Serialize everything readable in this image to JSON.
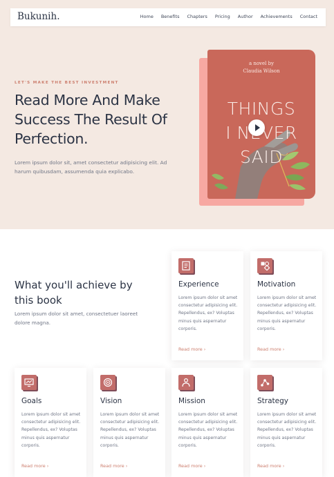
{
  "brand": "Bukunih.",
  "nav": [
    "Home",
    "Benefits",
    "Chapters",
    "Pricing",
    "Author",
    "Achievements",
    "Contact"
  ],
  "hero": {
    "eyebrow": "LET'S MAKE THE BEST INVESTMENT",
    "headline": "Read More And Make Success The Result Of Perfection.",
    "text": "Lorem ipsum dolor sit, amet consectetur adipisicing elit. Ad harum quibusdam, assumenda quia explicabo."
  },
  "book": {
    "subtitle_line1": "a novel by",
    "subtitle_line2": "Claudia Wilson",
    "title_line1": "THINGS",
    "title_line2": "I NEVER",
    "title_line3": "SAID",
    "play_icon": "play-icon"
  },
  "achieve": {
    "title": "What you'll achieve by this book",
    "text": "Lorem ipsum dolor sit amet, consectetuer laoreet dolore magna."
  },
  "cards": [
    {
      "title": "Experience",
      "icon": "document-icon",
      "text": "Lorem ipsum dolor sit amet consectetur adipisicing elit. Repellendus, ex? Voluptas minus quis aspernatur corporis.",
      "link": "Read more"
    },
    {
      "title": "Motivation",
      "icon": "shapes-icon",
      "text": "Lorem ipsum dolor sit amet consectetur adipisicing elit. Repellendus, ex? Voluptas minus quis aspernatur corporis.",
      "link": "Read more"
    },
    {
      "title": "Goals",
      "icon": "monitor-icon",
      "text": "Lorem ipsum dolor sit amet consectetur adipisicing elit. Repellendus, ex? Voluptas minus quis aspernatur corporis.",
      "link": "Read more"
    },
    {
      "title": "Vision",
      "icon": "target-icon",
      "text": "Lorem ipsum dolor sit amet consectetur adipisicing elit. Repellendus, ex? Voluptas minus quis aspernatur corporis.",
      "link": "Read more"
    },
    {
      "title": "Mission",
      "icon": "person-icon",
      "text": "Lorem ipsum dolor sit amet consectetur adipisicing elit. Repellendus, ex? Voluptas minus quis aspernatur corporis.",
      "link": "Read more"
    },
    {
      "title": "Strategy",
      "icon": "network-icon",
      "text": "Lorem ipsum dolor sit amet consectetur adipisicing elit. Repellendus, ex? Voluptas minus quis aspernatur corporis.",
      "link": "Read more"
    }
  ],
  "colors": {
    "hero_bg": "#f4e9e2",
    "accent": "#cc7e6e",
    "icon_bg": "#c26d6a",
    "book_cover": "#c9685a",
    "book_shadow": "#f7a8a2",
    "heading": "#2b3344"
  }
}
